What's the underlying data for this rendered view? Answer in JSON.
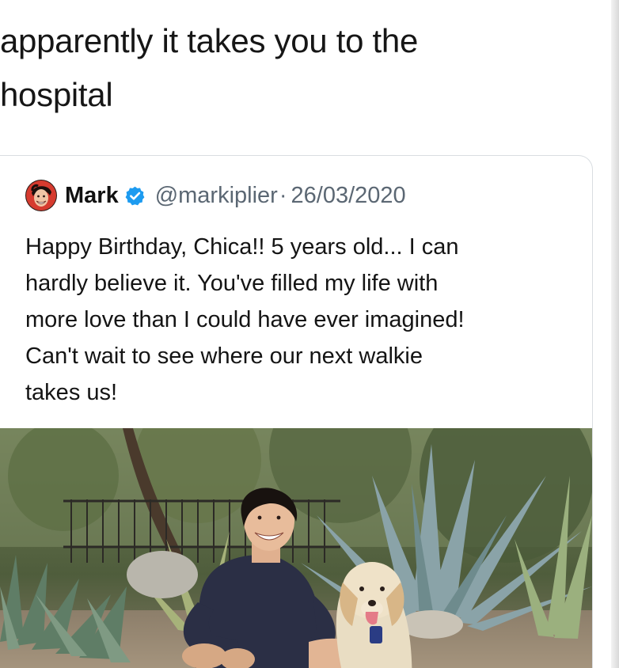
{
  "caption": {
    "line1": "apparently it takes you to the",
    "line2": "hospital"
  },
  "quoted_tweet": {
    "display_name": "Mark",
    "handle": "@markiplier",
    "separator": "·",
    "date": "26/03/2020",
    "text_lines": [
      "Happy Birthday, Chica!! 5 years old... I can",
      "hardly believe it. You've filled my life with",
      "more love than I could have ever imagined!",
      "Can't wait to see where our next walkie",
      "takes us!"
    ],
    "verified": true,
    "photo": {
      "subject": "man crouching with golden retriever in garden"
    }
  },
  "icons": {
    "verified": "verified-badge-icon",
    "avatar": "avatar"
  },
  "colors": {
    "background": "#ffffff",
    "text": "#141414",
    "muted": "#5b6773",
    "verified": "#1d9bf0",
    "card_border": "#d9dde1"
  }
}
